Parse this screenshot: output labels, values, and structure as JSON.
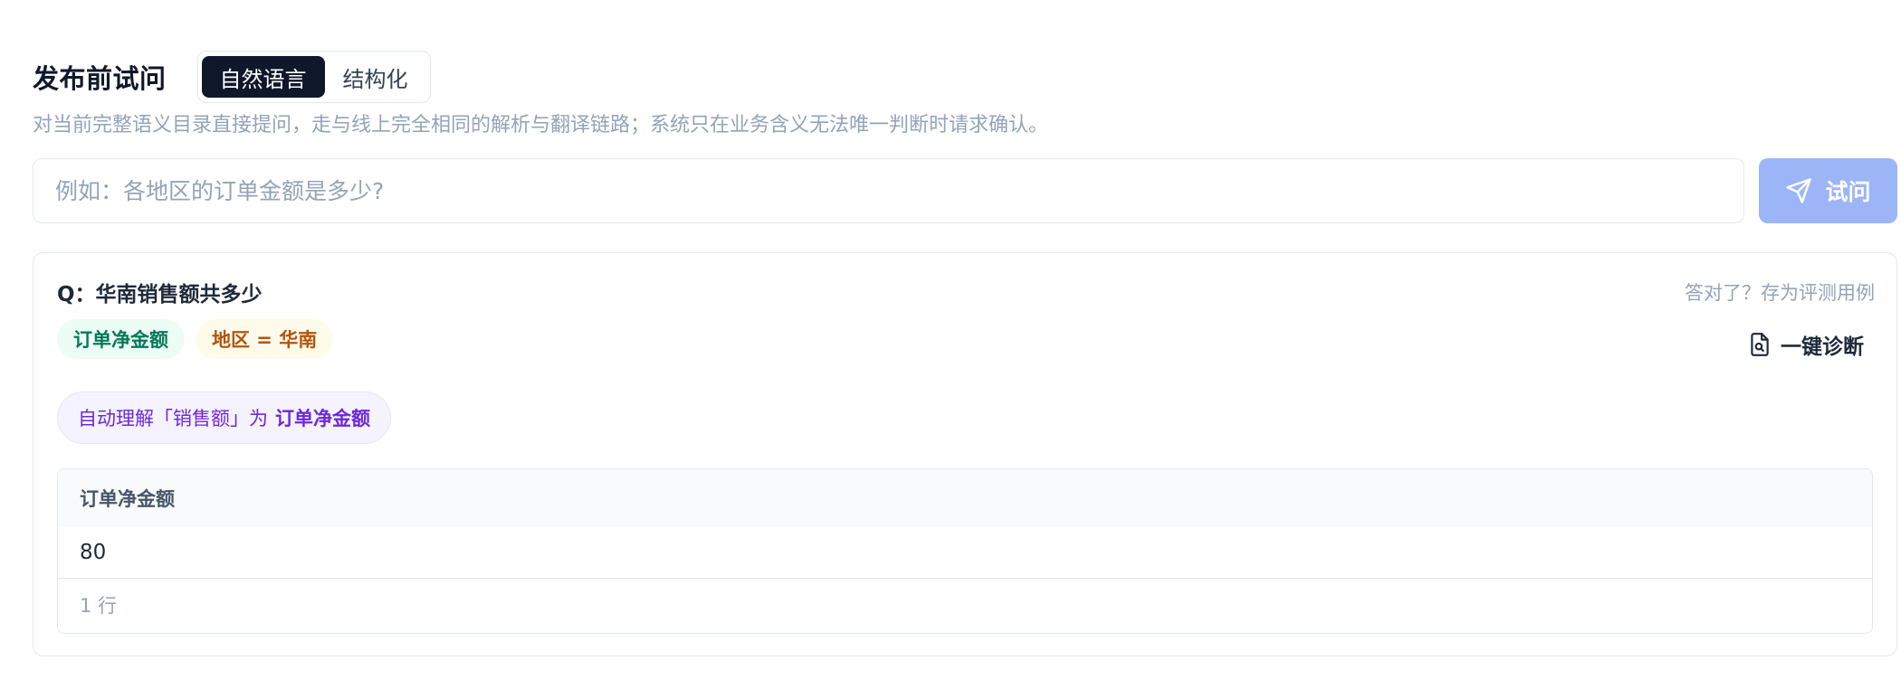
{
  "header": {
    "title": "发布前试问",
    "modes": [
      {
        "label": "自然语言",
        "active": true
      },
      {
        "label": "结构化",
        "active": false
      }
    ]
  },
  "subtitle": "对当前完整语义目录直接提问，走与线上完全相同的解析与翻译链路；系统只在业务含义无法唯一判断时请求确认。",
  "query": {
    "placeholder": "例如：各地区的订单金额是多少?",
    "value": "",
    "submit_label": "试问",
    "submit_icon": "send-icon"
  },
  "result": {
    "question": "Q：华南销售额共多少",
    "save_eval_label": "答对了？存为评测用例",
    "tags": {
      "metric": "订单净金额",
      "filter": "地区 = 华南"
    },
    "diagnose_label": "一键诊断",
    "diagnose_icon": "file-search-icon",
    "understanding": {
      "prefix": "自动理解「销售额」为",
      "term": "订单净金额"
    },
    "table": {
      "columns": [
        "订单净金额"
      ],
      "rows": [
        [
          "80"
        ]
      ],
      "row_count": "1 行"
    }
  },
  "colors": {
    "primary_dark": "#0f172a",
    "button_disabled": "#9cb5f7",
    "metric_tag_bg": "#ecfdf5",
    "metric_tag_text": "#047857",
    "filter_tag_bg": "#fffbeb",
    "filter_tag_text": "#b45309",
    "understanding_bg": "#f5f3ff",
    "understanding_text": "#6d28d9",
    "muted_text": "#94a3b8"
  }
}
